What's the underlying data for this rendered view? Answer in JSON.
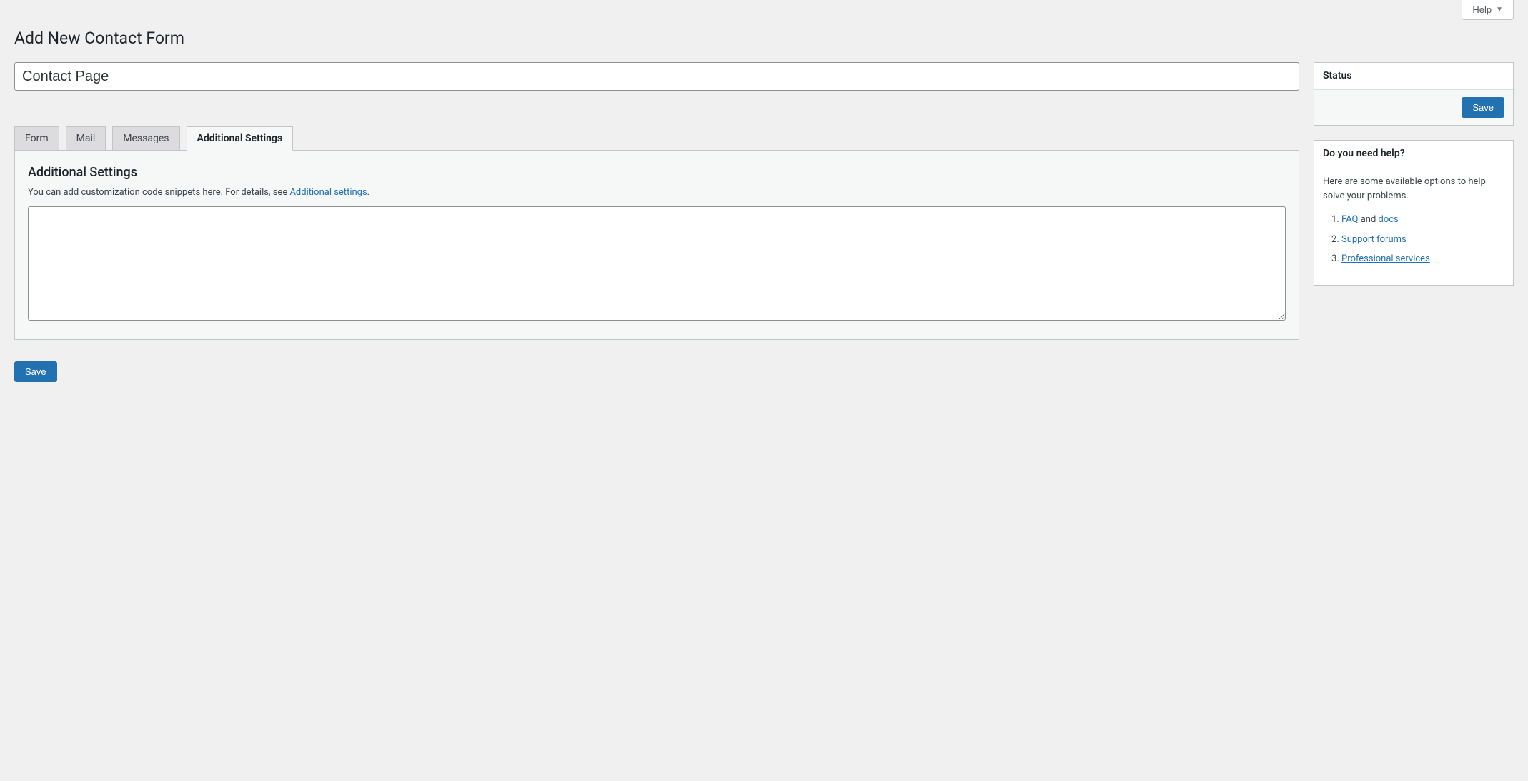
{
  "topbar": {
    "help_label": "Help"
  },
  "page": {
    "title": "Add New Contact Form",
    "form_title_value": "Contact Page"
  },
  "tabs": {
    "form": "Form",
    "mail": "Mail",
    "messages": "Messages",
    "additional": "Additional Settings"
  },
  "panel": {
    "heading": "Additional Settings",
    "desc_prefix": "You can add customization code snippets here. For details, see ",
    "desc_link": "Additional settings",
    "desc_suffix": ".",
    "textarea_value": ""
  },
  "buttons": {
    "save": "Save"
  },
  "sidebar": {
    "status": {
      "title": "Status"
    },
    "help": {
      "title": "Do you need help?",
      "intro": "Here are some available options to help solve your problems.",
      "item1_link1": "FAQ",
      "item1_middle": " and ",
      "item1_link2": "docs",
      "item2": "Support forums",
      "item3": "Professional services"
    }
  }
}
